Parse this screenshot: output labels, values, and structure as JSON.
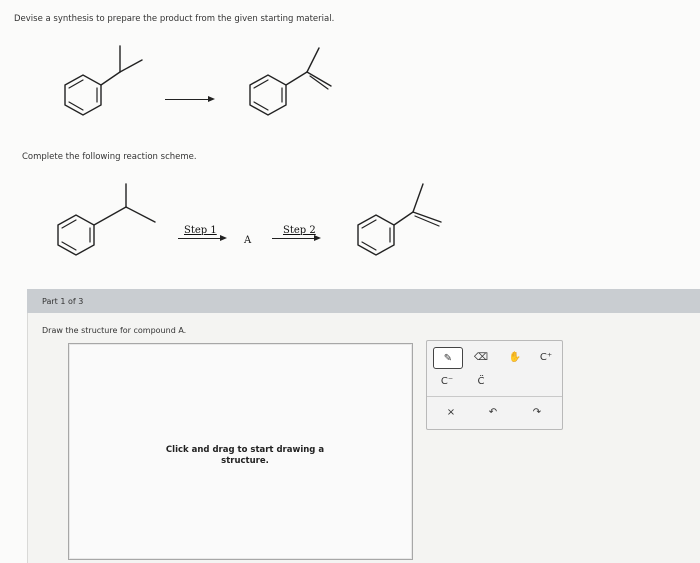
{
  "question": {
    "prompt": "Devise a synthesis to prepare the product from the given starting material.",
    "scheme_prompt": "Complete the following reaction scheme."
  },
  "scheme": {
    "step1_label": "Step 1",
    "intermediate_label": "A",
    "step2_label": "Step 2"
  },
  "part": {
    "label": "Part 1 of 3",
    "instruction": "Draw the structure for compound A."
  },
  "canvas": {
    "hint": "Click and drag to start drawing a structure."
  },
  "toolbar": {
    "tools": [
      {
        "name": "pencil-tool",
        "icon": "pencil-icon",
        "glyph": "✎",
        "active": true
      },
      {
        "name": "eraser-tool",
        "icon": "eraser-icon",
        "glyph": "⌫",
        "active": false
      },
      {
        "name": "hand-tool",
        "icon": "hand-icon",
        "glyph": "✋",
        "active": false
      },
      {
        "name": "carbocation-tool",
        "icon": "carbocation-icon",
        "glyph": "C⁺",
        "active": false
      },
      {
        "name": "carbanion-tool",
        "icon": "carbanion-icon",
        "glyph": "C⁻",
        "active": false
      },
      {
        "name": "lone-pair-tool",
        "icon": "lone-pair-icon",
        "glyph": "C̈",
        "active": false
      },
      {
        "name": "clear-tool",
        "icon": "close-icon",
        "glyph": "×",
        "active": false
      },
      {
        "name": "undo-tool",
        "icon": "undo-icon",
        "glyph": "↶",
        "active": false
      },
      {
        "name": "redo-tool",
        "icon": "redo-icon",
        "glyph": "↷",
        "active": false
      }
    ]
  }
}
